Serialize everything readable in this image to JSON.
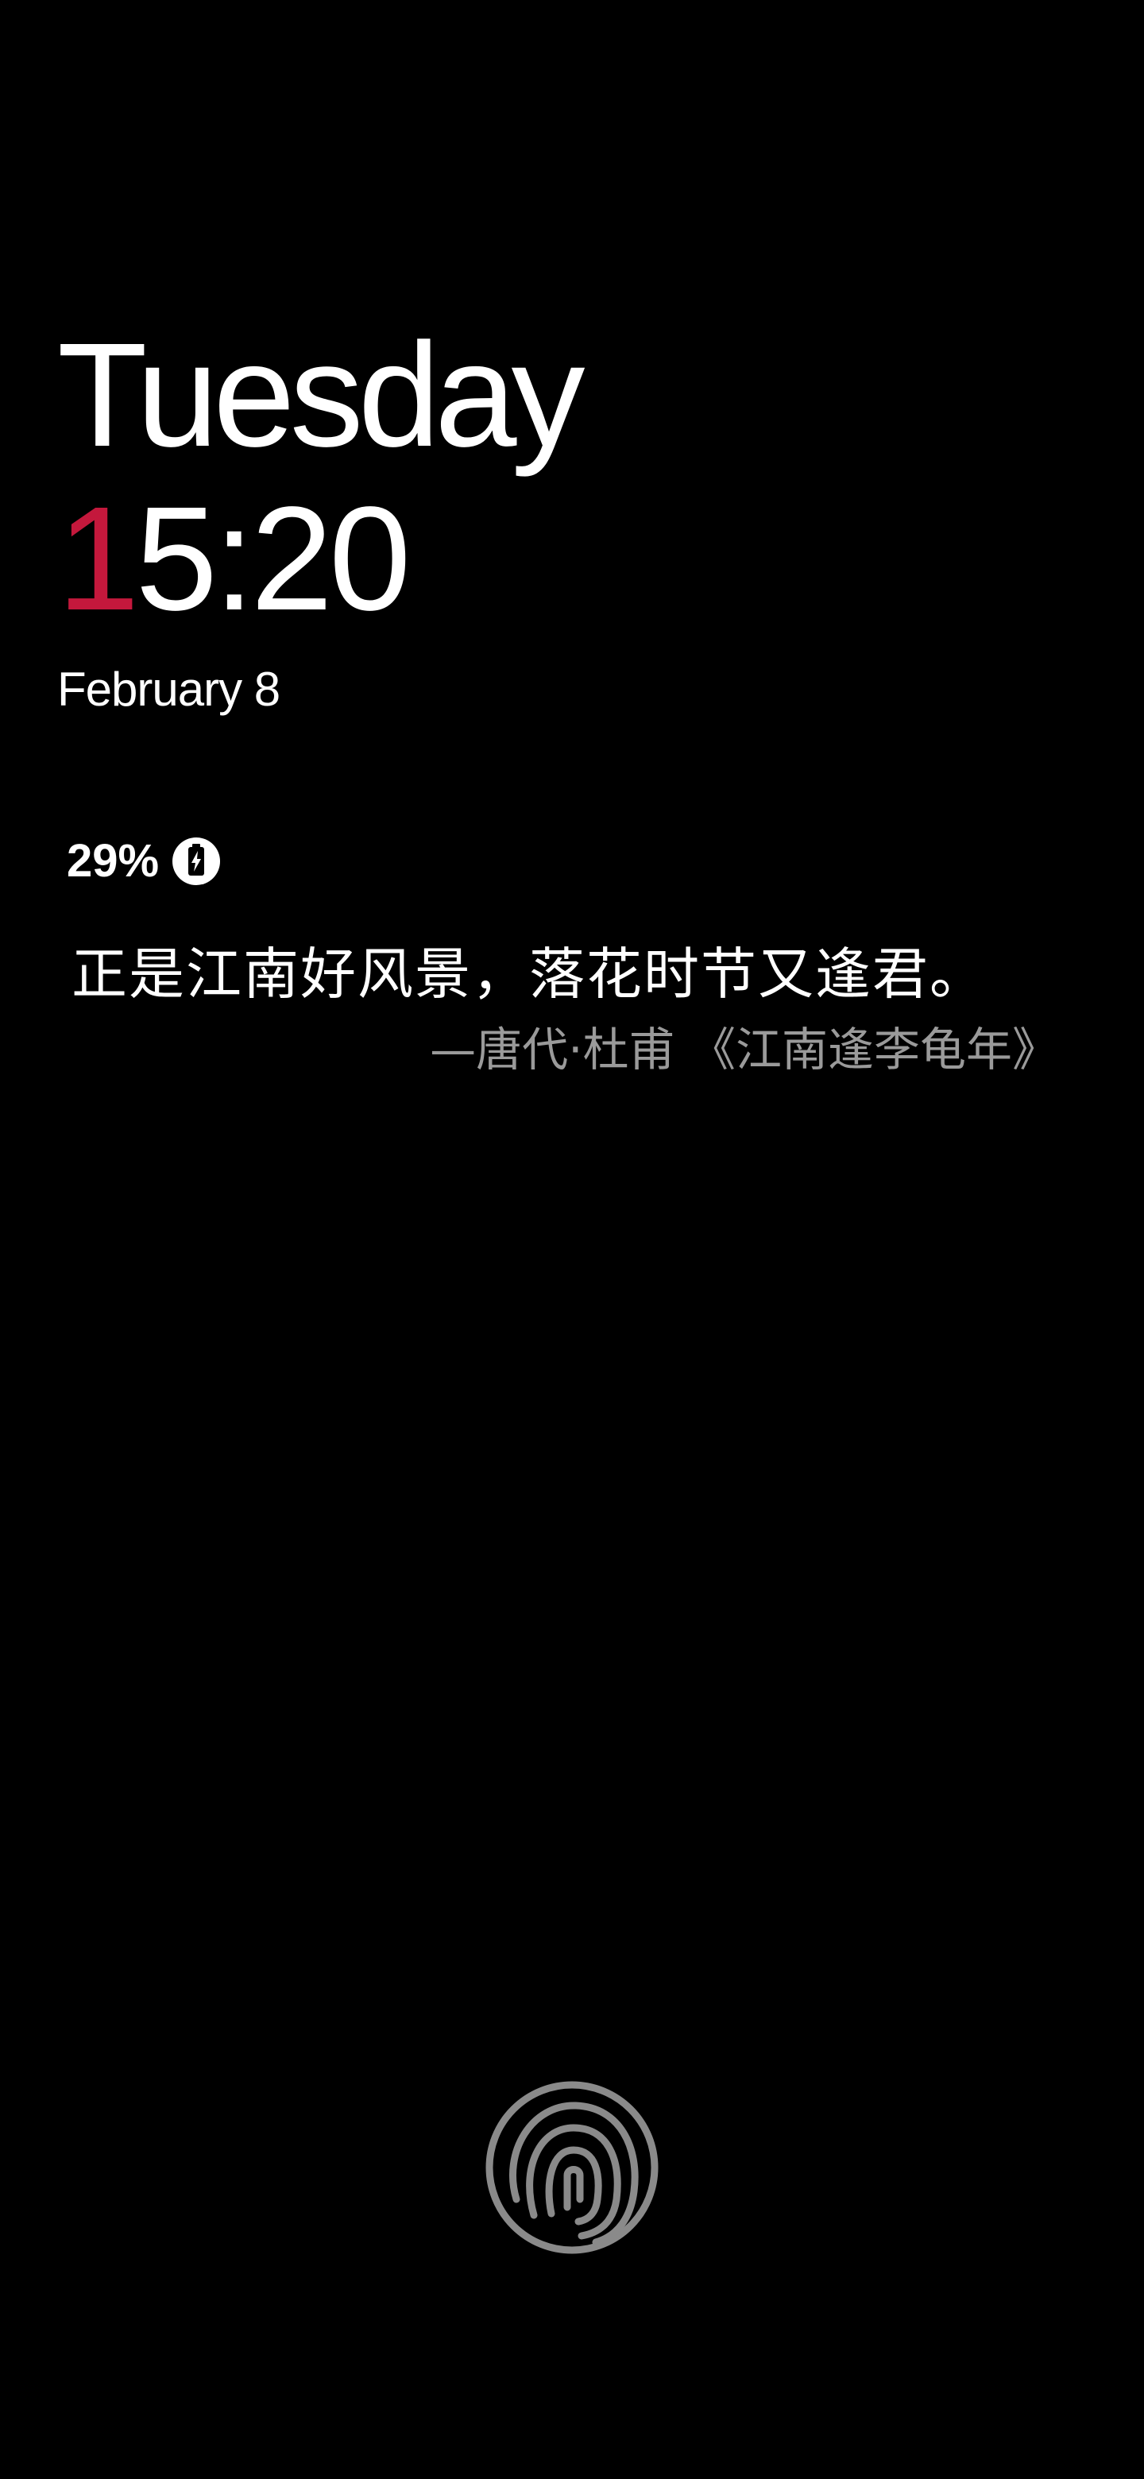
{
  "lockscreen": {
    "day": "Tuesday",
    "time_first_digit": "1",
    "time_rest": "5:20",
    "date": "February 8",
    "accent_color": "#c4183c"
  },
  "battery": {
    "percent_text": "29%",
    "icon": "battery-charging-icon"
  },
  "poem": {
    "line": "正是江南好风景，落花时节又逢君。",
    "attribution": "—唐代·杜甫 《江南逢李龟年》"
  },
  "fingerprint": {
    "icon": "fingerprint-icon"
  }
}
